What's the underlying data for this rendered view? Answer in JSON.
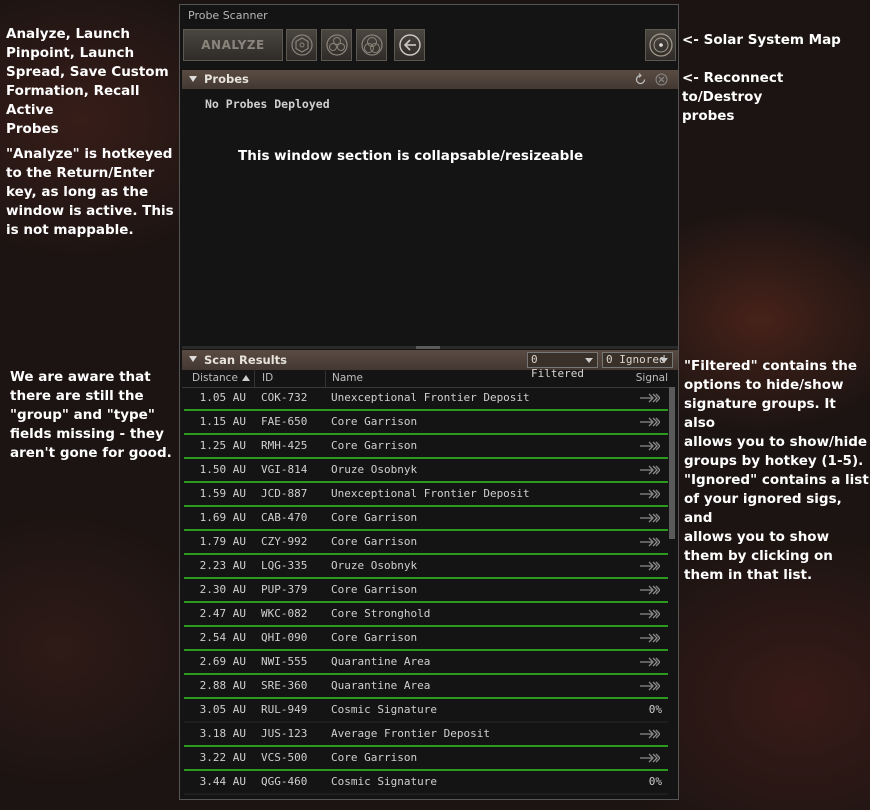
{
  "notes": {
    "left_top": [
      "Analyze, Launch",
      "Pinpoint, Launch",
      "Spread, Save Custom",
      "Formation, Recall Active",
      "Probes"
    ],
    "left_mid": [
      "\"Analyze\" is hotkeyed",
      "to the Return/Enter",
      "key, as long as the",
      "window is active. This",
      "is not mappable."
    ],
    "left_bottom": [
      "We are aware that",
      "there are still the",
      "\"group\" and \"type\"",
      "fields missing - they",
      "aren't gone for good."
    ],
    "right_map": "<- Solar System Map",
    "right_reconnect": [
      "<- Reconnect to/Destroy",
      "probes"
    ],
    "right_filtered": [
      "\"Filtered\" contains the",
      "options to hide/show",
      "signature groups. It also",
      "allows you to show/hide",
      "groups by hotkey (1-5)."
    ],
    "right_ignored": [
      "\"Ignored\" contains a list",
      "of your ignored sigs, and",
      "allows you to show",
      "them by clicking on",
      "them in that list."
    ],
    "center": "This window section is collapsable/resizeable"
  },
  "window": {
    "title": "Probe Scanner",
    "analyze_label": "ANALYZE",
    "probes_header": "Probes",
    "no_probes": "No Probes Deployed",
    "scan_header": "Scan Results",
    "filtered_label": "0 Filtered",
    "ignored_label": "0 Ignored"
  },
  "columns": {
    "distance": "Distance",
    "id": "ID",
    "name": "Name",
    "signal": "Signal"
  },
  "colors": {
    "green_line": "#2b9a1f",
    "header_bg": "#4f433a"
  },
  "results": [
    {
      "distance": "1.05 AU",
      "id": "COK-732",
      "name": "Unexceptional Frontier Deposit",
      "signal": "",
      "warp": true
    },
    {
      "distance": "1.15 AU",
      "id": "FAE-650",
      "name": "Core Garrison",
      "signal": "",
      "warp": true
    },
    {
      "distance": "1.25 AU",
      "id": "RMH-425",
      "name": "Core Garrison",
      "signal": "",
      "warp": true
    },
    {
      "distance": "1.50 AU",
      "id": "VGI-814",
      "name": "Oruze Osobnyk",
      "signal": "",
      "warp": true
    },
    {
      "distance": "1.59 AU",
      "id": "JCD-887",
      "name": "Unexceptional Frontier Deposit",
      "signal": "",
      "warp": true
    },
    {
      "distance": "1.69 AU",
      "id": "CAB-470",
      "name": "Core Garrison",
      "signal": "",
      "warp": true
    },
    {
      "distance": "1.79 AU",
      "id": "CZY-992",
      "name": "Core Garrison",
      "signal": "",
      "warp": true
    },
    {
      "distance": "2.23 AU",
      "id": "LQG-335",
      "name": "Oruze Osobnyk",
      "signal": "",
      "warp": true
    },
    {
      "distance": "2.30 AU",
      "id": "PUP-379",
      "name": "Core Garrison",
      "signal": "",
      "warp": true
    },
    {
      "distance": "2.47 AU",
      "id": "WKC-082",
      "name": "Core Stronghold",
      "signal": "",
      "warp": true
    },
    {
      "distance": "2.54 AU",
      "id": "QHI-090",
      "name": "Core Garrison",
      "signal": "",
      "warp": true
    },
    {
      "distance": "2.69 AU",
      "id": "NWI-555",
      "name": "Quarantine Area",
      "signal": "",
      "warp": true
    },
    {
      "distance": "2.88 AU",
      "id": "SRE-360",
      "name": "Quarantine Area",
      "signal": "",
      "warp": true
    },
    {
      "distance": "3.05 AU",
      "id": "RUL-949",
      "name": "Cosmic Signature",
      "signal": "0%",
      "warp": false
    },
    {
      "distance": "3.18 AU",
      "id": "JUS-123",
      "name": "Average Frontier Deposit",
      "signal": "",
      "warp": true
    },
    {
      "distance": "3.22 AU",
      "id": "VCS-500",
      "name": "Core Garrison",
      "signal": "",
      "warp": true
    },
    {
      "distance": "3.44 AU",
      "id": "QGG-460",
      "name": "Cosmic Signature",
      "signal": "0%",
      "warp": false
    }
  ]
}
